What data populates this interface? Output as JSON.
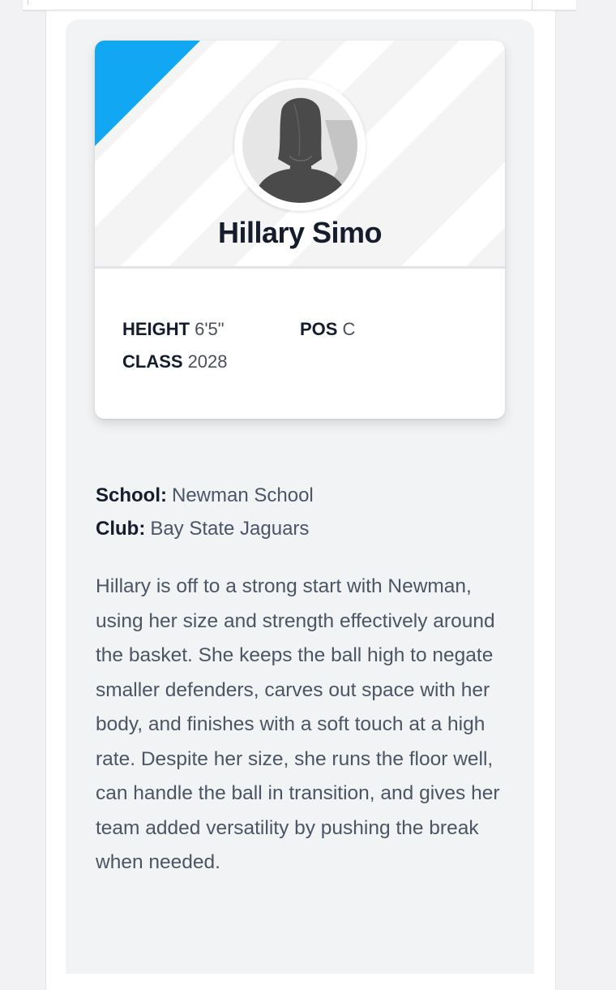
{
  "player": {
    "name": "Hillary Simo",
    "avatar_icon": "person-silhouette-icon",
    "stats": {
      "height": {
        "label": "HEIGHT",
        "value": "6'5\""
      },
      "position": {
        "label": "POS",
        "value": "C"
      },
      "class": {
        "label": "CLASS",
        "value": "2028"
      }
    }
  },
  "info": {
    "school": {
      "label": "School:",
      "value": "Newman School"
    },
    "club": {
      "label": "Club:",
      "value": "Bay State Jaguars"
    }
  },
  "bio": "Hillary is off to a strong start with Newman, using her size and strength effectively around the basket. She keeps the ball high to negate smaller defenders, carves out space with her body, and finishes with a soft touch at a high rate. Despite her size, she runs the floor well, can handle the ball in transition, and gives her team added versatility by pushing the break when needed.",
  "colors": {
    "accent": "#12a7f2",
    "name_text": "#151c2c",
    "body_text": "#4b5563",
    "panel_background": "#f2f3f5"
  }
}
